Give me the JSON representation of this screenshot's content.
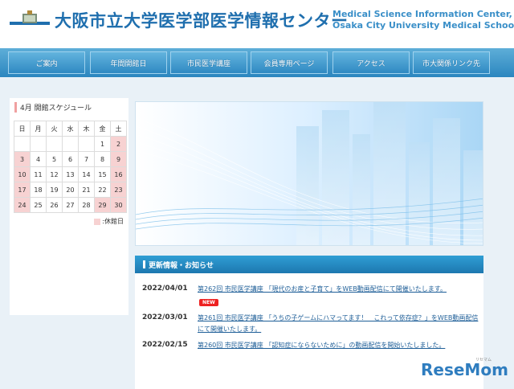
{
  "header": {
    "title_jp": "大阪市立大学医学部医学情報センター",
    "title_en_1": "Medical Science Information Center,",
    "title_en_2": "Osaka City University Medical School"
  },
  "nav": {
    "items": [
      "ご案内",
      "年間開館日",
      "市民医学講座",
      "会員専用ページ",
      "アクセス",
      "市大関係リンク先"
    ]
  },
  "calendar": {
    "title": "4月 開館スケジュール",
    "weekdays": [
      "日",
      "月",
      "火",
      "水",
      "木",
      "金",
      "土"
    ],
    "weeks": [
      [
        "",
        "",
        "",
        "",
        "",
        "1",
        "2"
      ],
      [
        "3",
        "4",
        "5",
        "6",
        "7",
        "8",
        "9"
      ],
      [
        "10",
        "11",
        "12",
        "13",
        "14",
        "15",
        "16"
      ],
      [
        "17",
        "18",
        "19",
        "20",
        "21",
        "22",
        "23"
      ],
      [
        "24",
        "25",
        "26",
        "27",
        "28",
        "29",
        "30"
      ]
    ],
    "closed_days": [
      "2",
      "3",
      "9",
      "10",
      "16",
      "17",
      "23",
      "24",
      "29",
      "30"
    ],
    "legend": ":休館日"
  },
  "news": {
    "heading": "更新情報・お知らせ",
    "new_badge": "NEW",
    "items": [
      {
        "date": "2022/04/01",
        "text": "第262回 市民医学講座 「現代のお産と子育て」をWEB動画配信にて開催いたします。"
      },
      {
        "date": "2022/03/01",
        "text": "第261回 市民医学講座 「うちの子ゲームにハマってます！　これって依存症？」をWEB動画配信にて開催いたします。"
      },
      {
        "date": "2022/02/15",
        "text": "第260回 市民医学講座 「認知症にならないために」の動画配信を開始いたしました。"
      }
    ]
  },
  "watermark": {
    "brand": "ReseMom",
    "sub": "リセマム"
  },
  "colors": {
    "accent": "#1f6fae",
    "nav": "#2b86bf",
    "closed": "#f7d2d2"
  }
}
